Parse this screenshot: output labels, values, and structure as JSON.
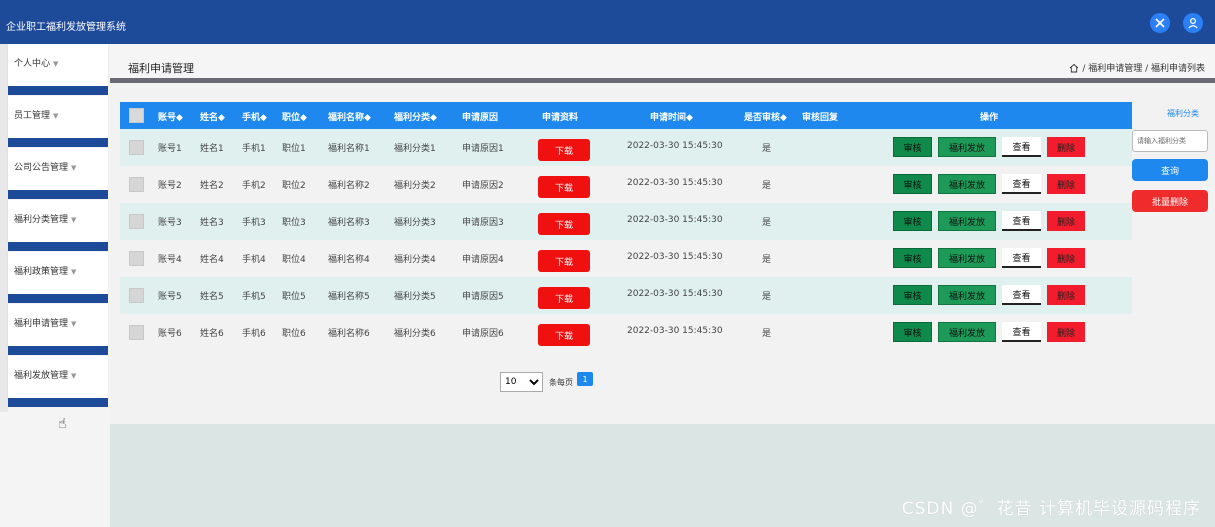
{
  "app": {
    "title": "企业职工福利发放管理系统"
  },
  "topbar": {
    "icons": [
      "crosshair-icon",
      "user-icon"
    ]
  },
  "sidebar": {
    "items": [
      {
        "label": "个人中心"
      },
      {
        "label": "员工管理"
      },
      {
        "label": "公司公告管理"
      },
      {
        "label": "福利分类管理"
      },
      {
        "label": "福利政策管理"
      },
      {
        "label": "福利申请管理"
      },
      {
        "label": "福利发放管理"
      }
    ],
    "arrow": "▼"
  },
  "header": {
    "title": "福利申请管理",
    "breadcrumb": "/ 福利申请管理 / 福利申请列表"
  },
  "table": {
    "columns": [
      "账号◆",
      "姓名◆",
      "手机◆",
      "职位◆",
      "福利名称◆",
      "福利分类◆",
      "申请原因",
      "申请资料",
      "申请时间◆",
      "是否审核◆",
      "审核回复",
      "操作"
    ],
    "rows": [
      {
        "account": "账号1",
        "name": "姓名1",
        "phone": "手机1",
        "position": "职位1",
        "welfare": "福利名称1",
        "category": "福利分类1",
        "reason": "申请原因1",
        "time": "2022-03-30 15:45:30",
        "audited": "是"
      },
      {
        "account": "账号2",
        "name": "姓名2",
        "phone": "手机2",
        "position": "职位2",
        "welfare": "福利名称2",
        "category": "福利分类2",
        "reason": "申请原因2",
        "time": "2022-03-30 15:45:30",
        "audited": "是"
      },
      {
        "account": "账号3",
        "name": "姓名3",
        "phone": "手机3",
        "position": "职位3",
        "welfare": "福利名称3",
        "category": "福利分类3",
        "reason": "申请原因3",
        "time": "2022-03-30 15:45:30",
        "audited": "是"
      },
      {
        "account": "账号4",
        "name": "姓名4",
        "phone": "手机4",
        "position": "职位4",
        "welfare": "福利名称4",
        "category": "福利分类4",
        "reason": "申请原因4",
        "time": "2022-03-30 15:45:30",
        "audited": "是"
      },
      {
        "account": "账号5",
        "name": "姓名5",
        "phone": "手机5",
        "position": "职位5",
        "welfare": "福利名称5",
        "category": "福利分类5",
        "reason": "申请原因5",
        "time": "2022-03-30 15:45:30",
        "audited": "是"
      },
      {
        "account": "账号6",
        "name": "姓名6",
        "phone": "手机6",
        "position": "职位6",
        "welfare": "福利名称6",
        "category": "福利分类6",
        "reason": "申请原因6",
        "time": "2022-03-30 15:45:30",
        "audited": "是"
      }
    ],
    "actions": {
      "download": "下载",
      "review": "审核",
      "issue": "福利发放",
      "view": "查看",
      "delete": "删除"
    }
  },
  "filter": {
    "label": "福利分类",
    "placeholder": "请输入福利分类",
    "search": "查询",
    "batch_delete": "批量删除"
  },
  "pagination": {
    "page_size": "10",
    "per_page_label": "条每页",
    "current_page": "1"
  },
  "watermark": "CSDN @゛花昔 计算机毕设源码程序",
  "colors": {
    "topbar": "#1e4a9a",
    "table_header": "#1e88ee",
    "danger": "#f01010",
    "success": "#0f8a4a"
  }
}
